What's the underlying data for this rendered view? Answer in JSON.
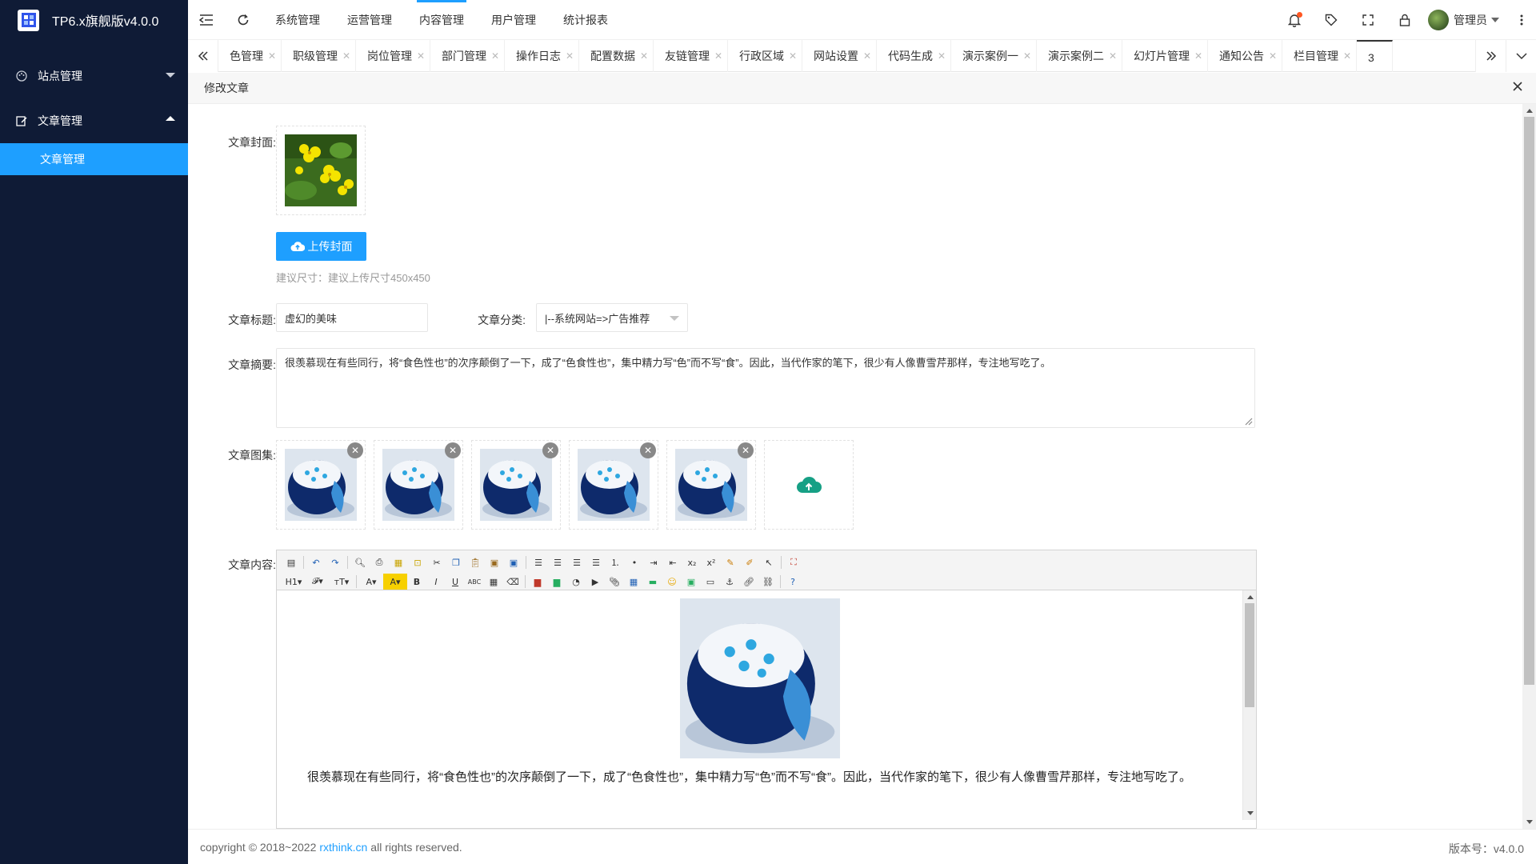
{
  "app": {
    "title": "TP6.x旗舰版v4.0.0"
  },
  "sidebar": {
    "groups": [
      {
        "label": "站点管理"
      },
      {
        "label": "文章管理",
        "children": [
          {
            "label": "文章管理"
          }
        ]
      }
    ]
  },
  "topmenu": {
    "items": [
      "系统管理",
      "运营管理",
      "内容管理",
      "用户管理",
      "统计报表"
    ],
    "active": "内容管理"
  },
  "header": {
    "user_name": "管理员",
    "notify_color": "#ff5722"
  },
  "tabs": [
    "色管理",
    "职级管理",
    "岗位管理",
    "部门管理",
    "操作日志",
    "配置数据",
    "友链管理",
    "行政区域",
    "网站设置",
    "代码生成",
    "演示案例一",
    "演示案例二",
    "幻灯片管理",
    "通知公告",
    "栏目管理",
    "3"
  ],
  "page": {
    "title": "修改文章",
    "cover": {
      "label": "文章封面:",
      "button": "上传封面",
      "hint": "建议尺寸：建议上传尺寸450x450"
    },
    "title_field": {
      "label": "文章标题:",
      "value": "虚幻的美味"
    },
    "category": {
      "label": "文章分类:",
      "value": "|--系统网站=>广告推荐"
    },
    "summary": {
      "label": "文章摘要:",
      "value": "很羡慕现在有些同行，将“食色性也”的次序颠倒了一下，成了“色食性也”，集中精力写“色”而不写“食”。因此，当代作家的笔下，很少有人像曹雪芹那样，专注地写吃了。"
    },
    "gallery": {
      "label": "文章图集:",
      "count": 5
    },
    "content": {
      "label": "文章内容:",
      "paragraph": "很羡慕现在有些同行，将“食色性也”的次序颠倒了一下，成了“色食性也”，集中精力写“色”而不写“食”。因此，当代作家的笔下，很少有人像曹雪芹那样，专注地写吃了。"
    }
  },
  "footer": {
    "copyright_pre": "copyright © 2018~2022",
    "link": "rxthink.cn",
    "copyright_post": "all rights reserved.",
    "version": "版本号：v4.0.0"
  },
  "colors": {
    "sidebar_bg": "#0f1b36",
    "accent": "#1e9fff",
    "upload_icon": "#16a085"
  }
}
